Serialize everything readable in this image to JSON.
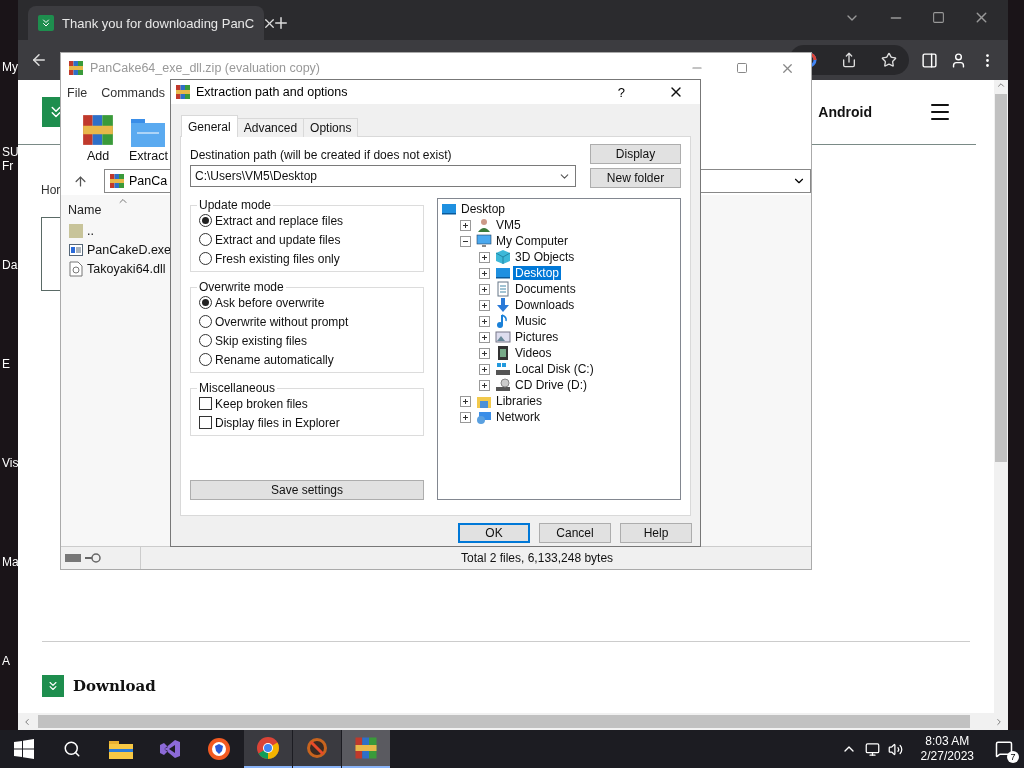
{
  "desktop_icons": [
    {
      "lines": [
        "My"
      ]
    },
    {
      "lines": [
        "SU",
        "Fr"
      ]
    },
    {
      "lines": [
        "Da"
      ]
    },
    {
      "lines": [
        "E"
      ]
    },
    {
      "lines": [
        "Vis"
      ]
    },
    {
      "lines": [
        "Ma"
      ]
    },
    {
      "lines": [
        "A"
      ]
    }
  ],
  "browser": {
    "tabs": [
      {
        "title": "Thank you for downloading PanC",
        "selected": true
      }
    ],
    "nav_link": "Android",
    "partial_link": "Hor",
    "section_heading": "Download"
  },
  "archive_window": {
    "title": "PanCake64_exe_dll.zip (evaluation copy)",
    "menu": [
      "File",
      "Commands"
    ],
    "toolbar": [
      {
        "label": "Add",
        "kind": "add"
      },
      {
        "label": "Extract",
        "kind": "extract"
      }
    ],
    "address": "PanCa",
    "column": "Name",
    "files": [
      {
        "name": "..",
        "kind": "folder"
      },
      {
        "name": "PanCakeD.exe",
        "kind": "exe"
      },
      {
        "name": "Takoyaki64.dll",
        "kind": "dll"
      }
    ],
    "status": "Total 2 files, 6,133,248 bytes"
  },
  "dialog": {
    "title": "Extraction path and options",
    "help": "?",
    "tabs": [
      {
        "label": "General",
        "selected": true
      },
      {
        "label": "Advanced",
        "selected": false
      },
      {
        "label": "Options",
        "selected": false
      }
    ],
    "destination_label": "Destination path (will be created if does not exist)",
    "destination_path": "C:\\Users\\VM5\\Desktop",
    "side_buttons": [
      "Display",
      "New folder"
    ],
    "groups": [
      {
        "title": "Update mode",
        "kind": "radio",
        "options": [
          {
            "label": "Extract and replace files",
            "selected": true
          },
          {
            "label": "Extract and update files",
            "selected": false
          },
          {
            "label": "Fresh existing files only",
            "selected": false
          }
        ]
      },
      {
        "title": "Overwrite mode",
        "kind": "radio",
        "options": [
          {
            "label": "Ask before overwrite",
            "selected": true
          },
          {
            "label": "Overwrite without prompt",
            "selected": false
          },
          {
            "label": "Skip existing files",
            "selected": false
          },
          {
            "label": "Rename automatically",
            "selected": false
          }
        ]
      },
      {
        "title": "Miscellaneous",
        "kind": "check",
        "options": [
          {
            "label": "Keep broken files",
            "checked": false
          },
          {
            "label": "Display files in Explorer",
            "checked": false
          }
        ]
      }
    ],
    "save_button": "Save settings",
    "tree": [
      {
        "label": "Desktop",
        "kind": "desktop",
        "selected": false,
        "children": [
          {
            "label": "VM5",
            "kind": "user",
            "selected": false,
            "expanded": false
          },
          {
            "label": "My Computer",
            "kind": "computer",
            "selected": false,
            "expanded": true,
            "children": [
              {
                "label": "3D Objects",
                "kind": "cube",
                "selected": false,
                "expanded": false
              },
              {
                "label": "Desktop",
                "kind": "desktop",
                "selected": true,
                "expanded": false
              },
              {
                "label": "Documents",
                "kind": "document",
                "selected": false,
                "expanded": false
              },
              {
                "label": "Downloads",
                "kind": "download",
                "selected": false,
                "expanded": false
              },
              {
                "label": "Music",
                "kind": "music",
                "selected": false,
                "expanded": false
              },
              {
                "label": "Pictures",
                "kind": "picture",
                "selected": false,
                "expanded": false
              },
              {
                "label": "Videos",
                "kind": "video",
                "selected": false,
                "expanded": false
              },
              {
                "label": "Local Disk (C:)",
                "kind": "disk",
                "selected": false,
                "expanded": false
              },
              {
                "label": "CD Drive (D:)",
                "kind": "cd",
                "selected": false,
                "expanded": false
              }
            ]
          },
          {
            "label": "Libraries",
            "kind": "library",
            "selected": false,
            "expanded": false
          },
          {
            "label": "Network",
            "kind": "network",
            "selected": false,
            "expanded": false
          }
        ]
      }
    ],
    "buttons": [
      {
        "label": "OK",
        "default": true
      },
      {
        "label": "Cancel",
        "default": false
      },
      {
        "label": "Help",
        "default": false
      }
    ]
  },
  "taskbar": {
    "apps": [
      {
        "kind": "explorer",
        "open": false,
        "selected": false
      },
      {
        "kind": "studio",
        "open": false,
        "selected": false
      },
      {
        "kind": "shield",
        "open": false,
        "selected": false
      },
      {
        "kind": "chrome",
        "open": true,
        "selected": false
      },
      {
        "kind": "blocked",
        "open": true,
        "selected": false
      },
      {
        "kind": "archiver",
        "open": true,
        "selected": true
      }
    ],
    "time": "8:03 AM",
    "date": "2/27/2023",
    "notifications": "7"
  }
}
